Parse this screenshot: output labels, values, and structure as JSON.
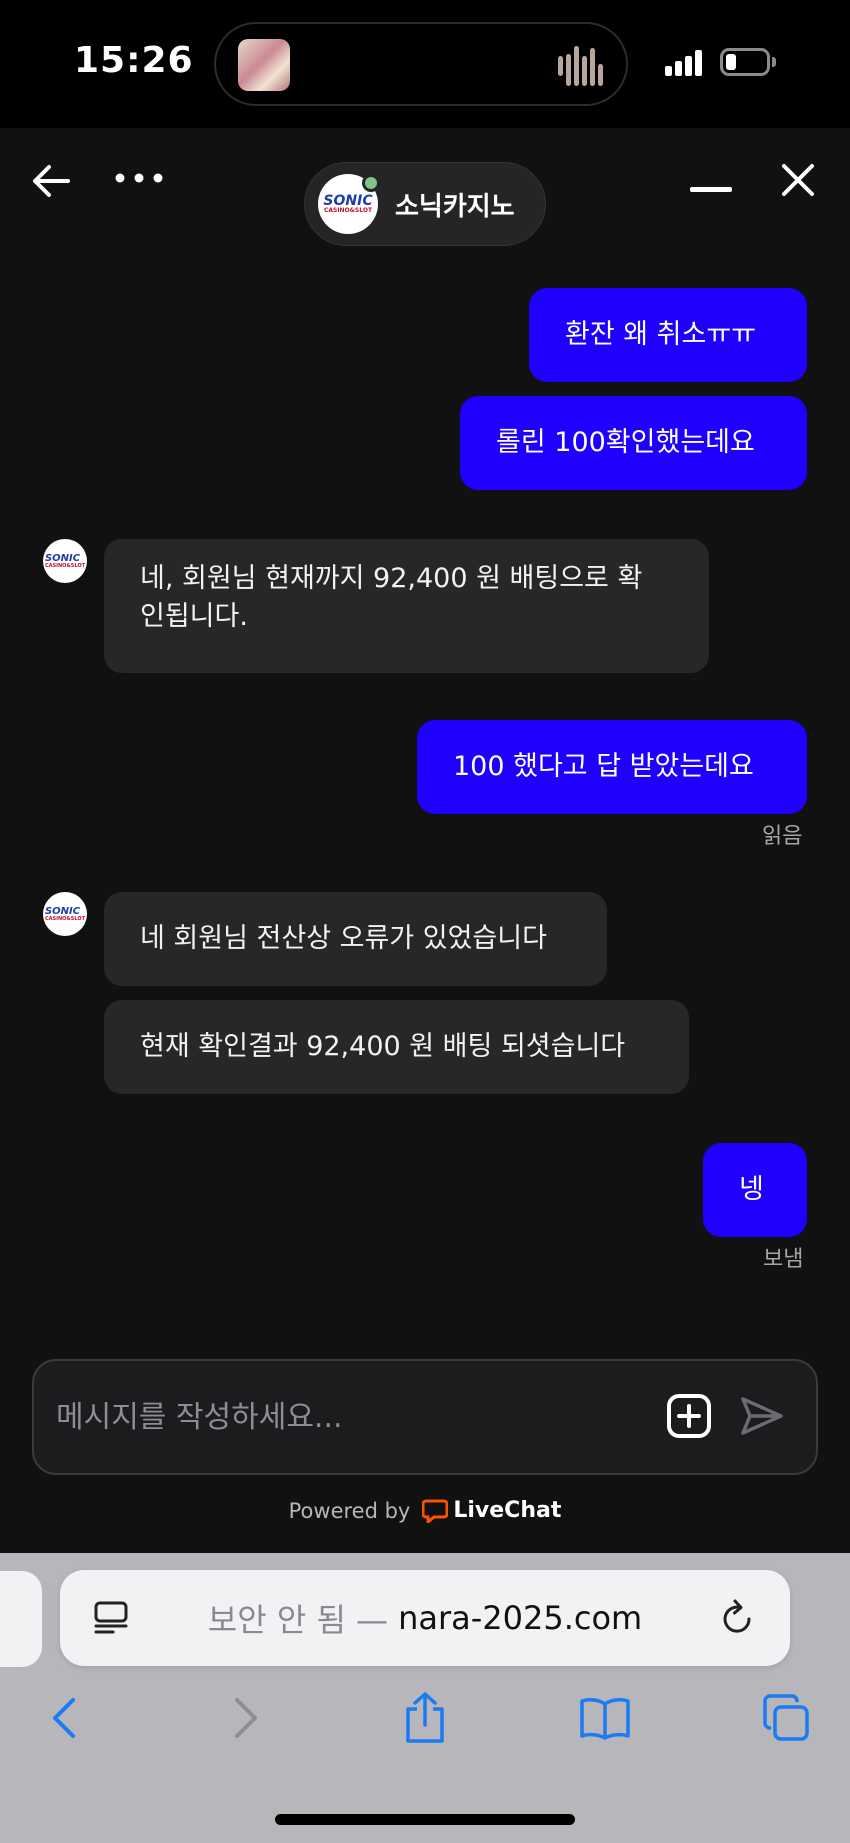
{
  "status_bar": {
    "time": "15:26"
  },
  "chat": {
    "agent_name": "소닉카지노",
    "logo_text_top": "SONIC",
    "logo_text_bottom": "CASINO&SLOT",
    "messages": [
      {
        "side": "outgoing",
        "text": "환잔 왜 취소ㅠㅠ"
      },
      {
        "side": "outgoing",
        "text": "롤린 100확인했는데요"
      },
      {
        "side": "incoming",
        "line1": "네, 회원님 현재까지 92,400 원 배팅으로 확",
        "line2": "인됩니다."
      },
      {
        "side": "outgoing",
        "text": "100 했다고 답 받았는데요",
        "receipt": "읽음"
      },
      {
        "side": "incoming",
        "text": "네 회원님 전산상 오류가 있었습니다"
      },
      {
        "side": "incoming",
        "text": "현재 확인결과 92,400 원 배팅 되셧습니다"
      },
      {
        "side": "outgoing",
        "text": "넹",
        "receipt": "보냄"
      }
    ],
    "composer_placeholder": "메시지를 작성하세요...",
    "powered_by": "Powered by",
    "brand": "LiveChat"
  },
  "safari": {
    "insecure_label": "보안 안 됨 —",
    "domain": "nara-2025.com"
  },
  "colors": {
    "outgoing_bubble": "#1f00ff",
    "incoming_bubble": "#272729",
    "chat_background": "#111112",
    "online_dot": "#7fc48b",
    "livechat_orange": "#ff5100",
    "safari_blue": "#1a7bf2"
  }
}
